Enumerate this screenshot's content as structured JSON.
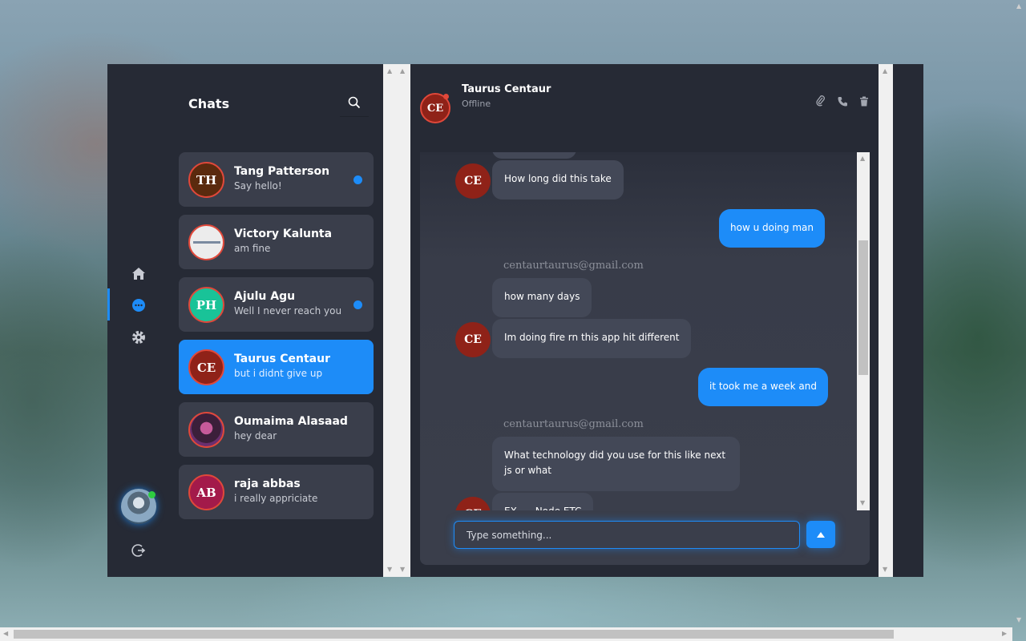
{
  "sidebar": {
    "nav": [
      {
        "icon": "home-icon"
      },
      {
        "icon": "chat-icon",
        "active": true
      },
      {
        "icon": "gear-icon"
      }
    ],
    "logout_icon": "logout-icon"
  },
  "chats": {
    "title": "Chats",
    "items": [
      {
        "initials": "TH",
        "name": "Tang Patterson",
        "message": "Say hello!",
        "unread": true,
        "avatar_color": "#5a2a0e"
      },
      {
        "initials": "",
        "name": "Victory Kalunta",
        "message": "am fine",
        "unread": false,
        "avatar_color": "#e8e8e8"
      },
      {
        "initials": "PH",
        "name": "Ajulu Agu",
        "message": "Well I never reach you",
        "unread": true,
        "avatar_color": "#19c398"
      },
      {
        "initials": "CE",
        "name": "Taurus Centaur",
        "message": "but i didnt give up",
        "unread": false,
        "avatar_color": "#8f2218",
        "active": true
      },
      {
        "initials": "",
        "name": "Oumaima Alasaad",
        "message": "hey dear",
        "unread": false,
        "avatar_color": "#3b1f3a"
      },
      {
        "initials": "AB",
        "name": "raja abbas",
        "message": "i really appriciate",
        "unread": false,
        "avatar_color": "#a31a4a"
      }
    ]
  },
  "conversation": {
    "contact_initials": "CE",
    "contact_name": "Taurus Centaur",
    "contact_status": "Offline",
    "messages": [
      {
        "type": "in",
        "avatar": "CE",
        "text": "How long did this take"
      },
      {
        "type": "out",
        "text": "how u doing man"
      },
      {
        "type": "sender",
        "text": "centaurtaurus@gmail.com"
      },
      {
        "type": "in",
        "text": "how many days"
      },
      {
        "type": "in",
        "avatar": "CE",
        "text": "Im doing fire rn this app hit different"
      },
      {
        "type": "out",
        "text": "it took me a week and"
      },
      {
        "type": "sender",
        "text": "centaurtaurus@gmail.com"
      },
      {
        "type": "in",
        "text": "What technology did you use for this like next js or what"
      },
      {
        "type": "in",
        "avatar": "CE",
        "text": "EX..... Node ETC"
      }
    ],
    "composer_placeholder": "Type something..."
  },
  "colors": {
    "accent": "#1d8cf8",
    "panel": "#262a35",
    "card": "#3a3e4b",
    "status_red": "#e0483a",
    "online_green": "#2ecc40"
  }
}
